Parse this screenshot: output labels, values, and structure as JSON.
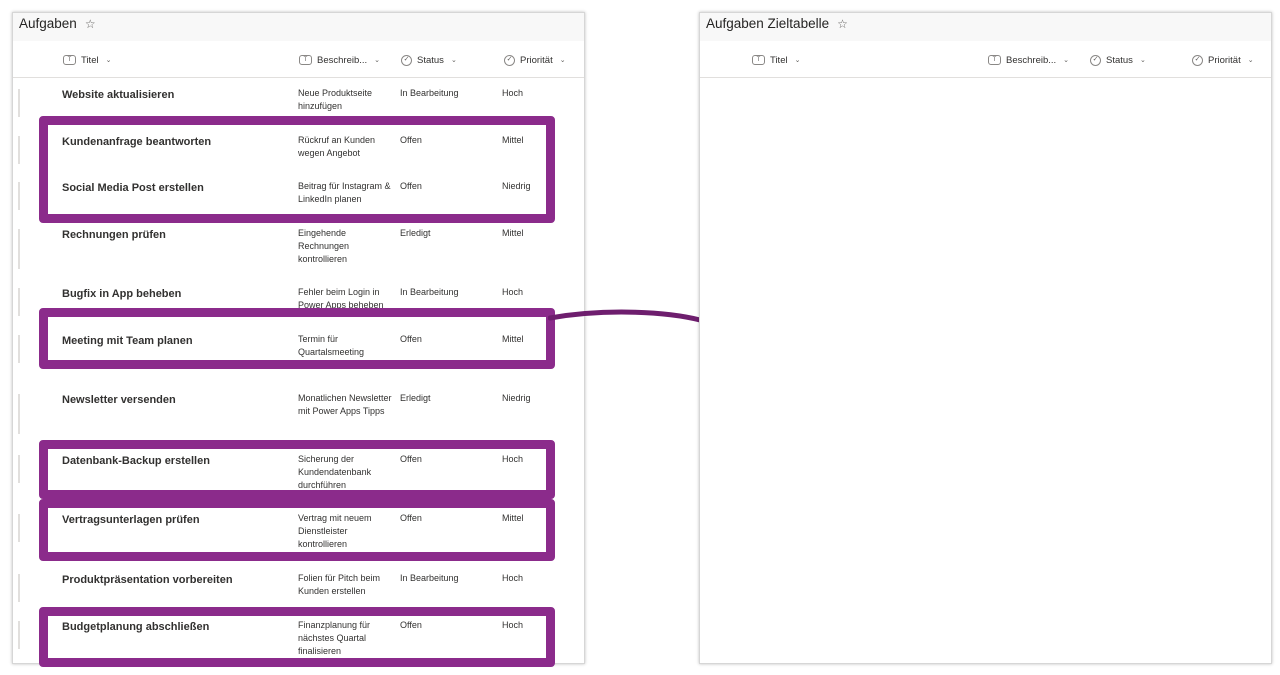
{
  "left": {
    "title": "Aufgaben",
    "columns": {
      "titel": "Titel",
      "beschreibung": "Beschreib...",
      "status": "Status",
      "prioritaet": "Priorität"
    },
    "rows": [
      {
        "title": "Website aktualisieren",
        "desc": "Neue Produktseite hinzufügen",
        "status": "In Bearbeitung",
        "prio": "Hoch"
      },
      {
        "title": "Kundenanfrage beantworten",
        "desc": "Rückruf an Kunden wegen Angebot",
        "status": "Offen",
        "prio": "Mittel"
      },
      {
        "title": "Social Media Post erstellen",
        "desc": "Beitrag für Instagram & LinkedIn planen",
        "status": "Offen",
        "prio": "Niedrig"
      },
      {
        "title": "Rechnungen prüfen",
        "desc": "Eingehende Rechnungen kontrollieren",
        "status": "Erledigt",
        "prio": "Mittel"
      },
      {
        "title": "Bugfix in App beheben",
        "desc": "Fehler beim Login in Power Apps beheben",
        "status": "In Bearbeitung",
        "prio": "Hoch"
      },
      {
        "title": "Meeting mit Team planen",
        "desc": "Termin für Quartalsmeeting",
        "status": "Offen",
        "prio": "Mittel"
      },
      {
        "title": "Newsletter versenden",
        "desc": "Monatlichen Newsletter mit Power Apps Tipps",
        "status": "Erledigt",
        "prio": "Niedrig"
      },
      {
        "title": "Datenbank-Backup erstellen",
        "desc": "Sicherung der Kundendatenbank durchführen",
        "status": "Offen",
        "prio": "Hoch"
      },
      {
        "title": "Vertragsunterlagen prüfen",
        "desc": "Vertrag mit neuem Dienstleister kontrollieren",
        "status": "Offen",
        "prio": "Mittel"
      },
      {
        "title": "Produktpräsentation vorbereiten",
        "desc": "Folien für Pitch beim Kunden erstellen",
        "status": "In Bearbeitung",
        "prio": "Hoch"
      },
      {
        "title": "Budgetplanung abschließen",
        "desc": "Finanzplanung für nächstes Quartal finalisieren",
        "status": "Offen",
        "prio": "Hoch"
      }
    ]
  },
  "right": {
    "title": "Aufgaben Zieltabelle",
    "columns": {
      "titel": "Titel",
      "beschreibung": "Beschreib...",
      "status": "Status",
      "prioritaet": "Priorität"
    }
  },
  "colors": {
    "highlight": "#8b2b8b",
    "arrow": "#6e1e6e"
  },
  "icons": {
    "text_column": "text-column-icon",
    "choice_column": "choice-column-icon",
    "favorite": "star-icon",
    "sort": "chevron-down-icon",
    "arrow": "arrow-right-icon"
  }
}
